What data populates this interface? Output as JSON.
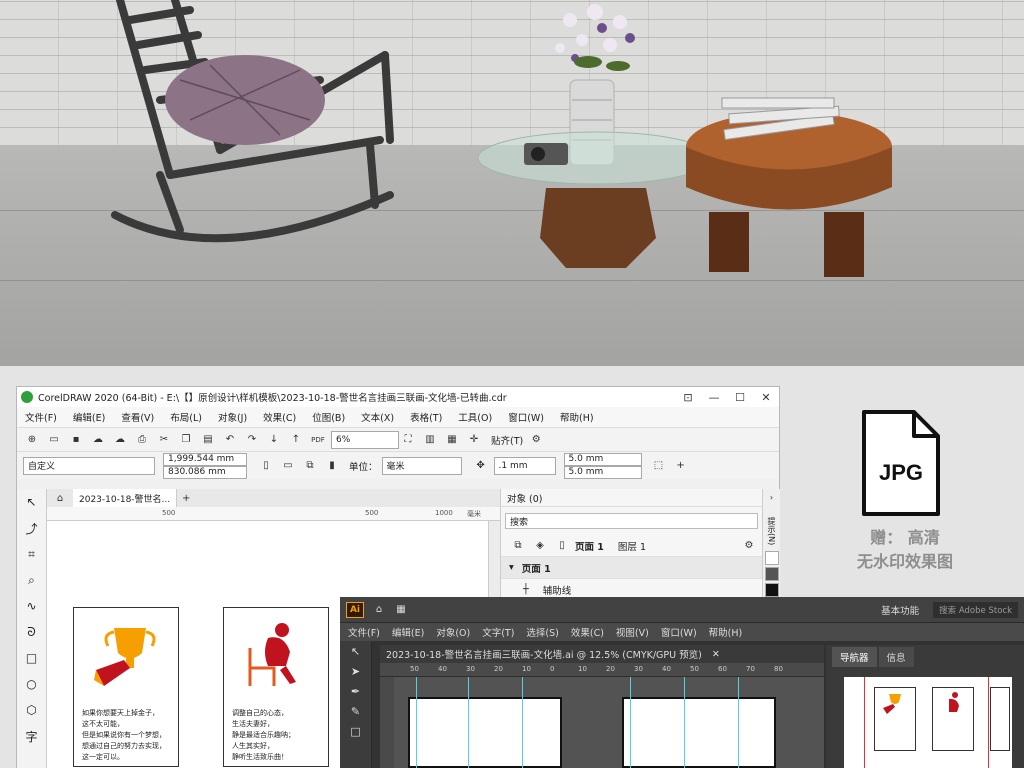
{
  "coreldraw": {
    "title": "CorelDRAW 2020 (64-Bit) - E:\\【】原创设计\\样机模板\\2023-10-18-警世名言挂画三联画-文化墙-已转曲.cdr",
    "menu": [
      "文件(F)",
      "编辑(E)",
      "查看(V)",
      "布局(L)",
      "对象(J)",
      "效果(C)",
      "位图(B)",
      "文本(X)",
      "表格(T)",
      "工具(O)",
      "窗口(W)",
      "帮助(H)"
    ],
    "toolbar": {
      "zoom": "6%",
      "snap": "贴齐(T)",
      "pdf": "PDF"
    },
    "propbar": {
      "preset": "自定义",
      "width": "1,999.544 mm",
      "height": "830.086 mm",
      "units_label": "单位：",
      "units_value": "毫米",
      "nudge": ".1 mm",
      "dup_x": "5.0 mm",
      "dup_y": "5.0 mm"
    },
    "doc_tab": "2023-10-18-警世名...",
    "ruler": [
      "500",
      "500",
      "1000",
      "毫米"
    ],
    "objects_panel": {
      "header": "对象 (0)",
      "search_placeholder": "搜索",
      "page_label": "页面 1",
      "layer_label": "图层 1",
      "tree_page": "页面 1",
      "tree_guides": "辅助线"
    },
    "side_hint": "提示(N)",
    "posters": [
      {
        "text": "如果你想要天上掉金子，\n这不太可能，\n但是如果说你有一个梦想，\n想通过自己的努力去实现，\n这一定可以。"
      },
      {
        "text": "调整自己的心态，\n生活夫妻好，\n静是最适合乐趣呐；\n人生其实好，\n静听生活致乐曲！"
      }
    ]
  },
  "illustrator": {
    "logo": "Ai",
    "workspace": "基本功能",
    "search_placeholder": "搜索 Adobe Stock",
    "menu": [
      "文件(F)",
      "编辑(E)",
      "对象(O)",
      "文字(T)",
      "选择(S)",
      "效果(C)",
      "视图(V)",
      "窗口(W)",
      "帮助(H)"
    ],
    "doc_tab": "2023-10-18-警世名言挂画三联画-文化墙.ai @ 12.5% (CMYK/GPU 预览)",
    "ruler": [
      "50",
      "40",
      "30",
      "20",
      "10",
      "0",
      "10",
      "20",
      "30",
      "40",
      "50",
      "60",
      "70",
      "80"
    ],
    "panels": [
      "导航器",
      "信息"
    ]
  },
  "badge": {
    "format": "JPG",
    "line1": "赠： 高清",
    "line2": "无水印效果图"
  },
  "colors": {
    "corel_green": "#2e9f3a",
    "ai_orange": "#ff9a00",
    "guide_cyan": "#4fd3e3",
    "trophy_yellow": "#f5a000",
    "figure_red": "#c1121f"
  }
}
